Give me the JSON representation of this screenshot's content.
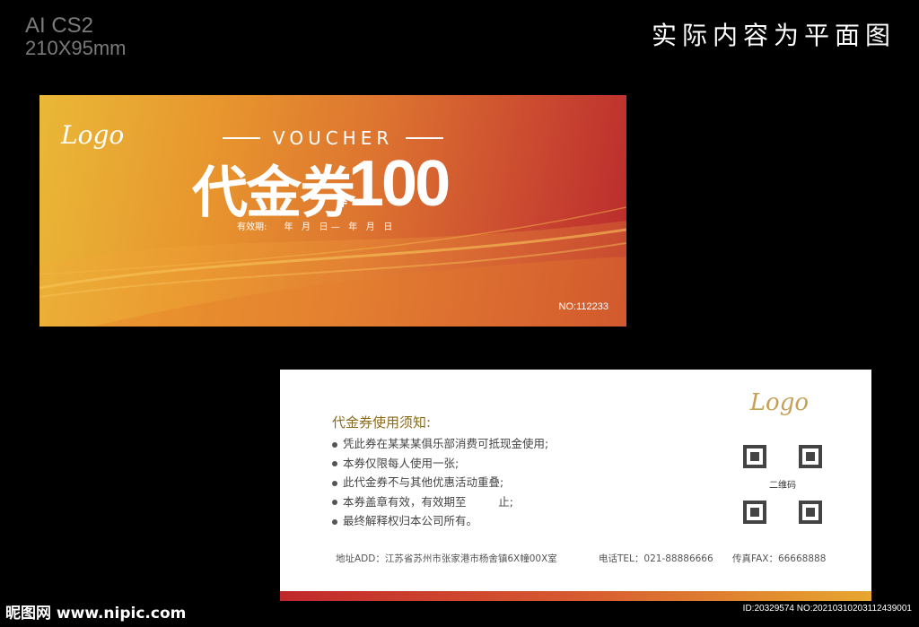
{
  "header": {
    "format": "AI CS2",
    "size": "210X95mm",
    "note": "实际内容为平面图"
  },
  "front": {
    "logo": "Logo",
    "voucher_en": "VOUCHER",
    "title_cn": "代金券",
    "currency": "¥",
    "amount": "100",
    "validity": "有效期:      年   月   日 —   年   月   日",
    "number": "NO:112233",
    "colors": {
      "gradient_start": "#e9b837",
      "gradient_end": "#b9292c"
    }
  },
  "back": {
    "logo": "Logo",
    "notice_title": "代金券使用须知:",
    "rules": [
      "凭此券在某某某俱乐部消费可抵现金使用;",
      "本券仅限每人使用一张;",
      "此代金券不与其他优惠活动重叠;",
      "本券盖章有效，有效期至         止;",
      "最终解释权归本公司所有。"
    ],
    "qr_label": "二维码",
    "address": "地址ADD：江苏省苏州市张家港市杨舍镇6X幢00X室",
    "tel": "电话TEL：021-88886666",
    "fax": "传真FAX：66668888",
    "title_color": "#8a6a1c"
  },
  "watermark": {
    "site": "昵图网 www.nipic.com",
    "id": "ID:20329574 NO:20210310203112439001"
  }
}
